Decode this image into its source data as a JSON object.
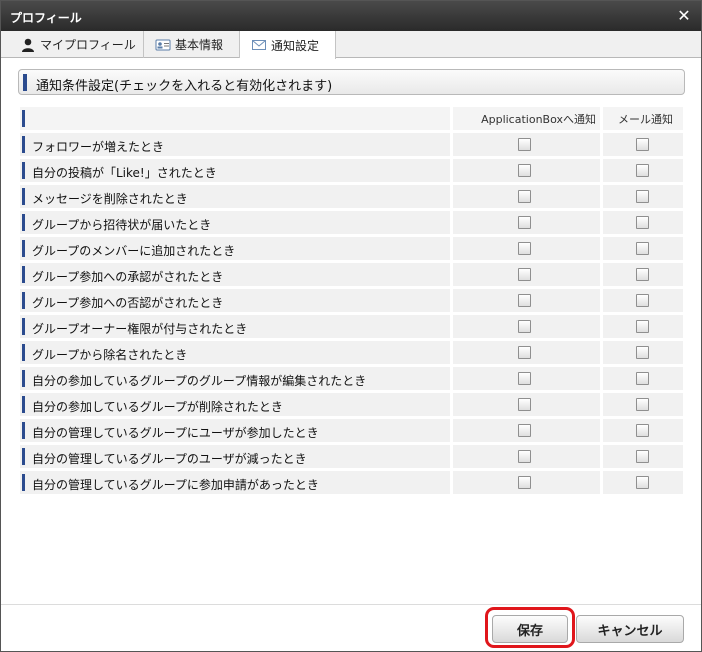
{
  "window": {
    "title": "プロフィール",
    "close_icon": "close-icon"
  },
  "tabs": [
    {
      "label": "マイプロフィール",
      "icon": "person-icon",
      "active": false
    },
    {
      "label": "基本情報",
      "icon": "id-card-icon",
      "active": false
    },
    {
      "label": "通知設定",
      "icon": "envelope-icon",
      "active": true
    }
  ],
  "section": {
    "title": "通知条件設定(チェックを入れると有効化されます)"
  },
  "table": {
    "columns": [
      "",
      "ApplicationBoxへ通知",
      "メール通知"
    ],
    "rows": [
      {
        "label": "フォロワーが増えたとき",
        "appbox": false,
        "mail": false
      },
      {
        "label": "自分の投稿が「Like!」されたとき",
        "appbox": false,
        "mail": false
      },
      {
        "label": "メッセージを削除されたとき",
        "appbox": false,
        "mail": false
      },
      {
        "label": "グループから招待状が届いたとき",
        "appbox": false,
        "mail": false
      },
      {
        "label": "グループのメンバーに追加されたとき",
        "appbox": false,
        "mail": false
      },
      {
        "label": "グループ参加への承認がされたとき",
        "appbox": false,
        "mail": false
      },
      {
        "label": "グループ参加への否認がされたとき",
        "appbox": false,
        "mail": false
      },
      {
        "label": "グループオーナー権限が付与されたとき",
        "appbox": false,
        "mail": false
      },
      {
        "label": "グループから除名されたとき",
        "appbox": false,
        "mail": false
      },
      {
        "label": "自分の参加しているグループのグループ情報が編集されたとき",
        "appbox": false,
        "mail": false
      },
      {
        "label": "自分の参加しているグループが削除されたとき",
        "appbox": false,
        "mail": false
      },
      {
        "label": "自分の管理しているグループにユーザが参加したとき",
        "appbox": false,
        "mail": false
      },
      {
        "label": "自分の管理しているグループのユーザが減ったとき",
        "appbox": false,
        "mail": false
      },
      {
        "label": "自分の管理しているグループに参加申請があったとき",
        "appbox": false,
        "mail": false
      }
    ]
  },
  "footer": {
    "save_label": "保存",
    "cancel_label": "キャンセル"
  },
  "colors": {
    "accent_bar": "#2b4b8e",
    "highlight": "#e0161b",
    "titlebar": "#333333"
  }
}
